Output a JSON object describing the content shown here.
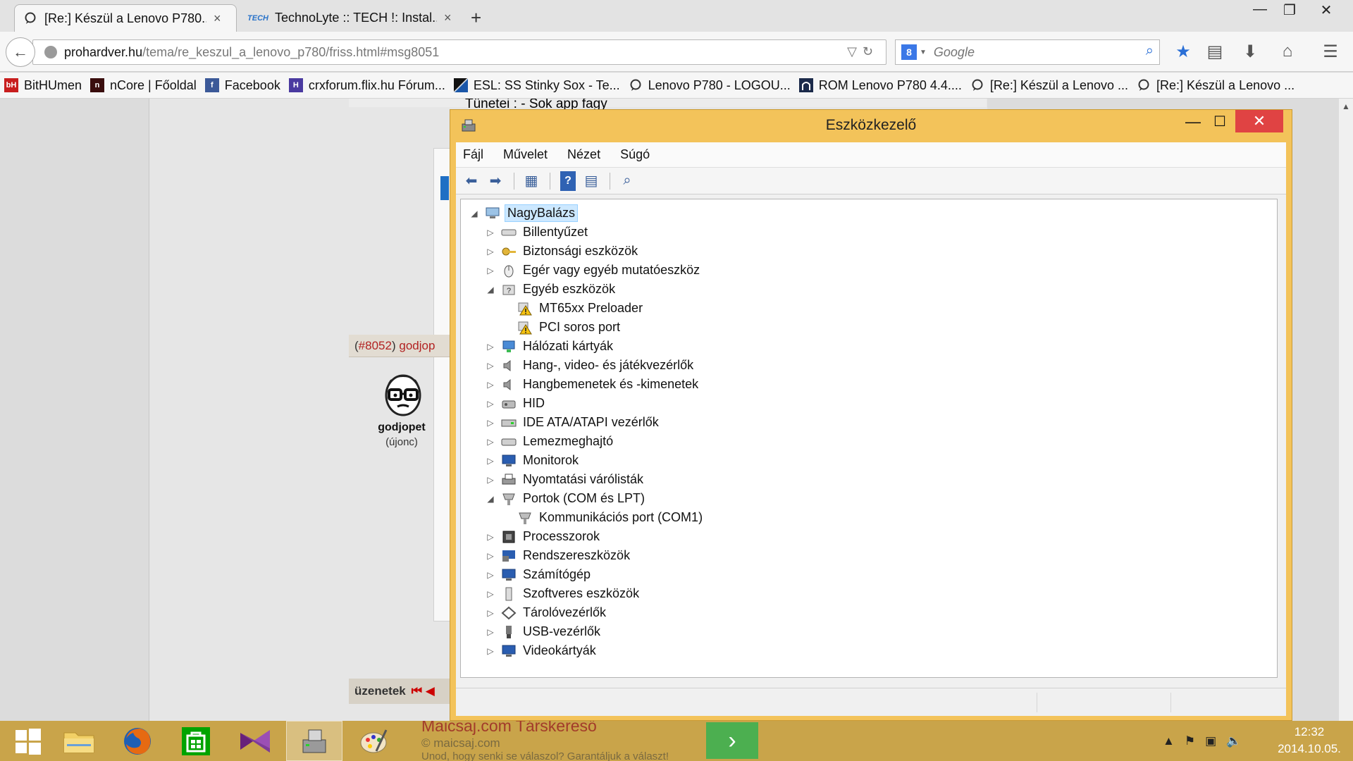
{
  "browser": {
    "tabs": [
      {
        "title": "[Re:] Készül a Lenovo P780...",
        "close": "×",
        "active": true
      },
      {
        "title": "TechnoLyte :: TECH !: Instal...",
        "close": "×",
        "active": false
      }
    ],
    "tab2_icon": "TECH",
    "new_tab": "+",
    "window_buttons": {
      "minimize": "—",
      "maximize": "❐",
      "close": "✕"
    },
    "url": {
      "host": "prohardver.hu",
      "path": "/tema/re_keszul_a_lenovo_p780/friss.html#msg8051"
    },
    "search_placeholder": "Google",
    "search_engine_icon": "8",
    "bookmarks": [
      {
        "label": "BitHUmen",
        "icon": "bH"
      },
      {
        "label": "nCore | Főoldal",
        "icon": "n"
      },
      {
        "label": "Facebook",
        "icon": "f"
      },
      {
        "label": "crxforum.flix.hu Fórum...",
        "icon": "H"
      },
      {
        "label": "ESL: SS Stinky Sox - Te...",
        "icon": ""
      },
      {
        "label": "Lenovo P780 - LOGOU...",
        "icon": ""
      },
      {
        "label": "ROM Lenovo P780 4.4....",
        "icon": ""
      },
      {
        "label": "[Re:] Készül a Lenovo ...",
        "icon": ""
      },
      {
        "label": "[Re:] Készül a Lenovo ...",
        "icon": ""
      }
    ]
  },
  "page": {
    "post_text": "Tünetei : - Sok app fagy",
    "post_header": {
      "open": "(",
      "num": "#8052",
      "close": ")",
      "author": "godjop"
    },
    "author": "godjopet",
    "rank": "(újonc)",
    "messages_label": "üzenetek",
    "messages_arrows": "⏮ ◀"
  },
  "device_manager": {
    "title": "Eszközkezelő",
    "menu": [
      "Fájl",
      "Művelet",
      "Nézet",
      "Súgó"
    ],
    "tree": [
      {
        "label": "NagyBalázs",
        "level": 0,
        "toggle": "◢",
        "icon": "computer",
        "selected": true
      },
      {
        "label": "Billentyűzet",
        "level": 1,
        "toggle": "▷",
        "icon": "keyboard"
      },
      {
        "label": "Biztonsági eszközök",
        "level": 1,
        "toggle": "▷",
        "icon": "key"
      },
      {
        "label": "Egér vagy egyéb mutatóeszköz",
        "level": 1,
        "toggle": "▷",
        "icon": "mouse"
      },
      {
        "label": "Egyéb eszközök",
        "level": 1,
        "toggle": "◢",
        "icon": "unknown"
      },
      {
        "label": "MT65xx Preloader",
        "level": 2,
        "toggle": "",
        "icon": "warning"
      },
      {
        "label": "PCI soros port",
        "level": 2,
        "toggle": "",
        "icon": "warning"
      },
      {
        "label": "Hálózati kártyák",
        "level": 1,
        "toggle": "▷",
        "icon": "network"
      },
      {
        "label": "Hang-, video- és játékvezérlők",
        "level": 1,
        "toggle": "▷",
        "icon": "speaker"
      },
      {
        "label": "Hangbemenetek és -kimenetek",
        "level": 1,
        "toggle": "▷",
        "icon": "speaker"
      },
      {
        "label": "HID",
        "level": 1,
        "toggle": "▷",
        "icon": "hid"
      },
      {
        "label": "IDE ATA/ATAPI vezérlők",
        "level": 1,
        "toggle": "▷",
        "icon": "ide"
      },
      {
        "label": "Lemezmeghajtó",
        "level": 1,
        "toggle": "▷",
        "icon": "disk"
      },
      {
        "label": "Monitorok",
        "level": 1,
        "toggle": "▷",
        "icon": "monitor"
      },
      {
        "label": "Nyomtatási várólisták",
        "level": 1,
        "toggle": "▷",
        "icon": "printer"
      },
      {
        "label": "Portok (COM és LPT)",
        "level": 1,
        "toggle": "◢",
        "icon": "port"
      },
      {
        "label": "Kommunikációs port (COM1)",
        "level": 2,
        "toggle": "",
        "icon": "port"
      },
      {
        "label": "Processzorok",
        "level": 1,
        "toggle": "▷",
        "icon": "cpu"
      },
      {
        "label": "Rendszereszközök",
        "level": 1,
        "toggle": "▷",
        "icon": "system"
      },
      {
        "label": "Számítógép",
        "level": 1,
        "toggle": "▷",
        "icon": "monitor"
      },
      {
        "label": "Szoftveres eszközök",
        "level": 1,
        "toggle": "▷",
        "icon": "software"
      },
      {
        "label": "Tárolóvezérlők",
        "level": 1,
        "toggle": "▷",
        "icon": "storage"
      },
      {
        "label": "USB-vezérlők",
        "level": 1,
        "toggle": "▷",
        "icon": "usb"
      },
      {
        "label": "Videokártyák",
        "level": 1,
        "toggle": "▷",
        "icon": "monitor"
      }
    ]
  },
  "taskbar": {
    "ad_title": "Maicsaj.com Társkereső",
    "ad_url": "maicsaj.com",
    "ad_sub": "Unod, hogy senki se válaszol? Garantáljuk a választ!",
    "ad_arrow": "›",
    "time": "12:32",
    "date": "2014.10.05."
  },
  "colors": {
    "accent": "#f3c35a",
    "taskbar": "#c9a44a",
    "close_red": "#e04343",
    "selection": "#cce8ff"
  }
}
